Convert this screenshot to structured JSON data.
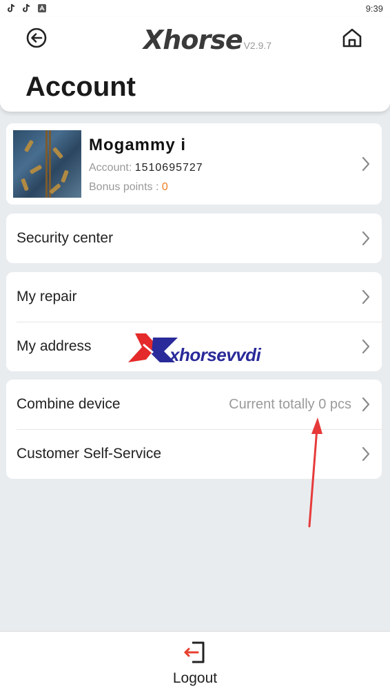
{
  "status_bar": {
    "time": "9:39",
    "icons": [
      "tiktok-icon",
      "tiktok-icon",
      "app-store-icon"
    ]
  },
  "header": {
    "brand": "Xhorse",
    "version": "V2.9.7",
    "title": "Account",
    "back_icon": "back-arrow-circle-icon",
    "home_icon": "home-icon"
  },
  "profile": {
    "name": "Mogammy i",
    "account_label": "Account: ",
    "account_value": "1510695727",
    "bonus_label": "Bonus points : ",
    "bonus_value": "0"
  },
  "menu": {
    "security_center": "Security center",
    "my_repair": "My repair",
    "my_address": "My address",
    "combine_device": "Combine device",
    "combine_device_value": "Current totally 0 pcs",
    "customer_self_service": "Customer Self-Service"
  },
  "watermark": {
    "text_a": "xhorse",
    "text_b": "vvdi"
  },
  "footer": {
    "logout": "Logout"
  },
  "colors": {
    "accent_orange": "#f07b1d",
    "logout_red": "#e8402e",
    "annotation_red": "#e63a3a",
    "background": "#e9ecef"
  }
}
